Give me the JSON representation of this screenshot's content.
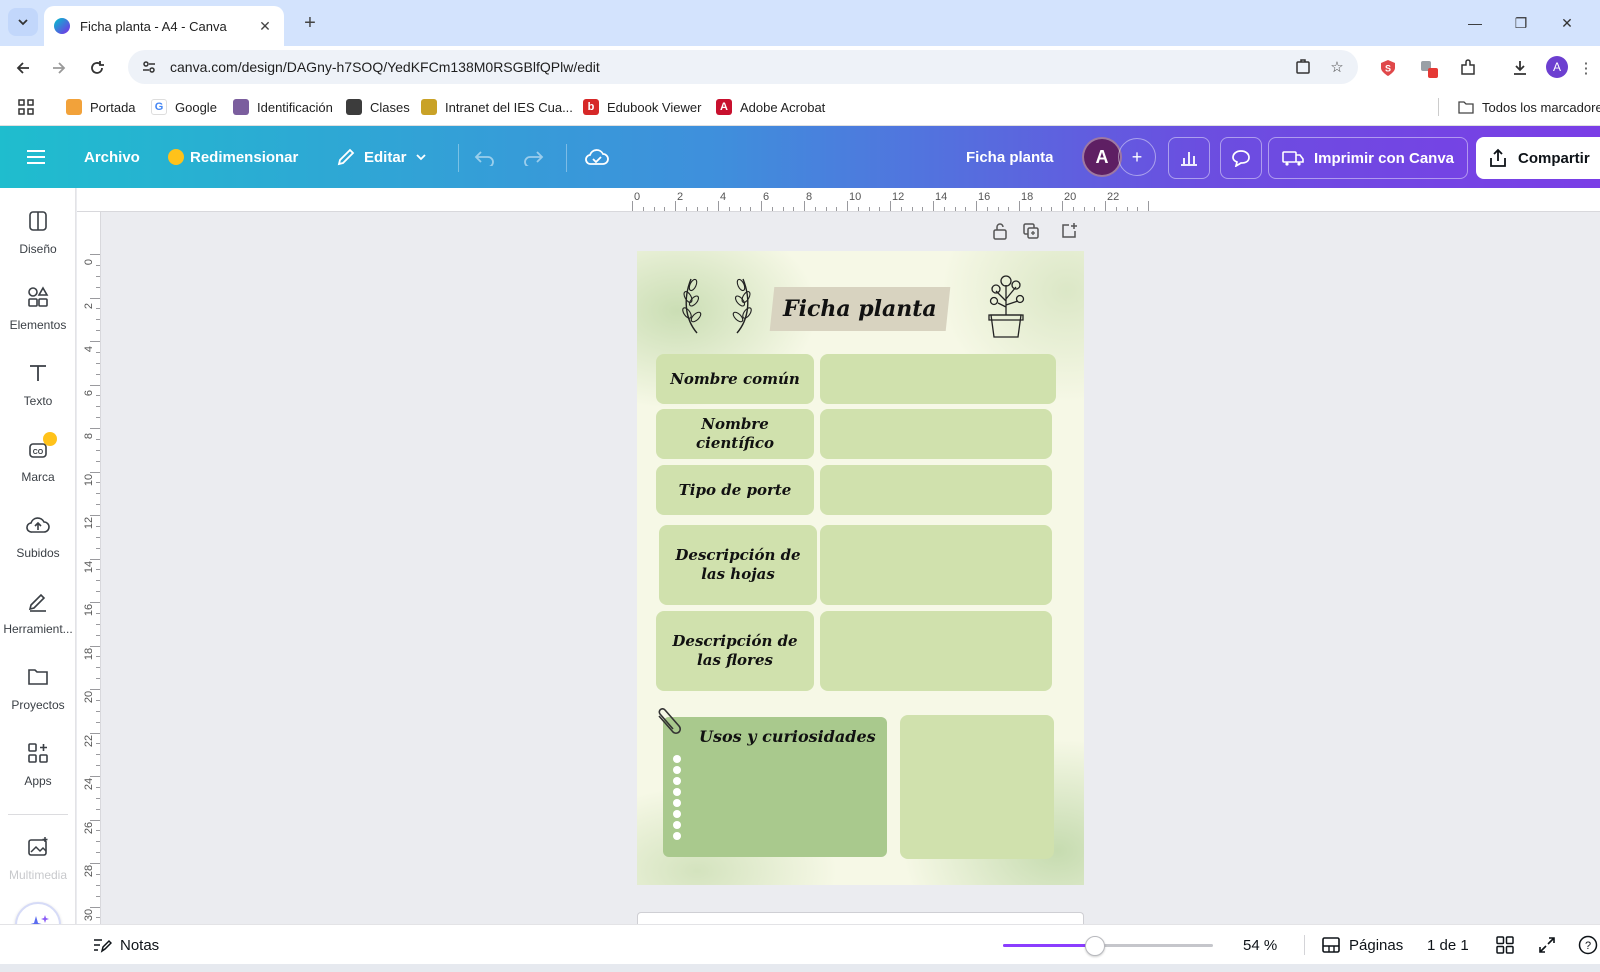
{
  "browser": {
    "tab_title": "Ficha planta - A4 - Canva",
    "url": "canva.com/design/DAGny-h7SOQ/YedKFCm138M0RSGBlfQPlw/edit",
    "extension_badge": "3",
    "profile_initial": "A",
    "bookmarks": [
      {
        "label": "Portada",
        "icon": "portada-icon",
        "color": "#f2a23a"
      },
      {
        "label": "Google",
        "icon": "google-icon",
        "color": "#4285f4"
      },
      {
        "label": "Identificación",
        "icon": "id-icon",
        "color": "#7b5e9e"
      },
      {
        "label": "Clases",
        "icon": "classes-icon",
        "color": "#3c3c3c"
      },
      {
        "label": "Intranet del IES Cua...",
        "icon": "intranet-icon",
        "color": "#c9a227"
      },
      {
        "label": "Edubook Viewer",
        "icon": "edubook-icon",
        "color": "#d62828"
      },
      {
        "label": "Adobe Acrobat",
        "icon": "acrobat-icon",
        "color": "#c8102e"
      }
    ],
    "all_bookmarks": "Todos los marcadores"
  },
  "canva_top": {
    "menu": "Archivo",
    "resize": "Redimensionar",
    "edit": "Editar",
    "doc_title": "Ficha planta",
    "avatar": "A",
    "print": "Imprimir con Canva",
    "share": "Compartir",
    "brand_gradient": [
      "#1fbdce",
      "#7a3ee6"
    ]
  },
  "sidebar": {
    "items": [
      {
        "label": "Diseño",
        "icon": "design-icon"
      },
      {
        "label": "Elementos",
        "icon": "elements-icon"
      },
      {
        "label": "Texto",
        "icon": "text-icon"
      },
      {
        "label": "Marca",
        "icon": "brand-icon"
      },
      {
        "label": "Subidos",
        "icon": "uploads-icon"
      },
      {
        "label": "Herramient...",
        "icon": "tools-icon"
      },
      {
        "label": "Proyectos",
        "icon": "projects-icon"
      },
      {
        "label": "Apps",
        "icon": "apps-icon"
      },
      {
        "label": "Multimedia",
        "icon": "media-icon"
      }
    ]
  },
  "rulers": {
    "horizontal": [
      "0",
      "2",
      "4",
      "6",
      "8",
      "10",
      "12",
      "14",
      "16",
      "18",
      "20",
      "22"
    ],
    "vertical": [
      "0",
      "2",
      "4",
      "6",
      "8",
      "10",
      "12",
      "14",
      "16",
      "18",
      "20",
      "22",
      "24",
      "26",
      "28",
      "30"
    ]
  },
  "design": {
    "title": "Ficha planta",
    "rows": [
      {
        "label": "Nombre común"
      },
      {
        "label": "Nombre científico"
      },
      {
        "label": "Tipo de porte"
      },
      {
        "label": "Descripción de las hojas"
      },
      {
        "label": "Descripción de las flores"
      }
    ],
    "uses_title": "Usos y curiosidades",
    "box_color": "#d0e1ad",
    "uses_color": "#a9c98d"
  },
  "bottom": {
    "notes": "Notas",
    "zoom_percent": 54,
    "zoom_label": "54 %",
    "pages": "Páginas",
    "page_count": "1 de 1"
  }
}
